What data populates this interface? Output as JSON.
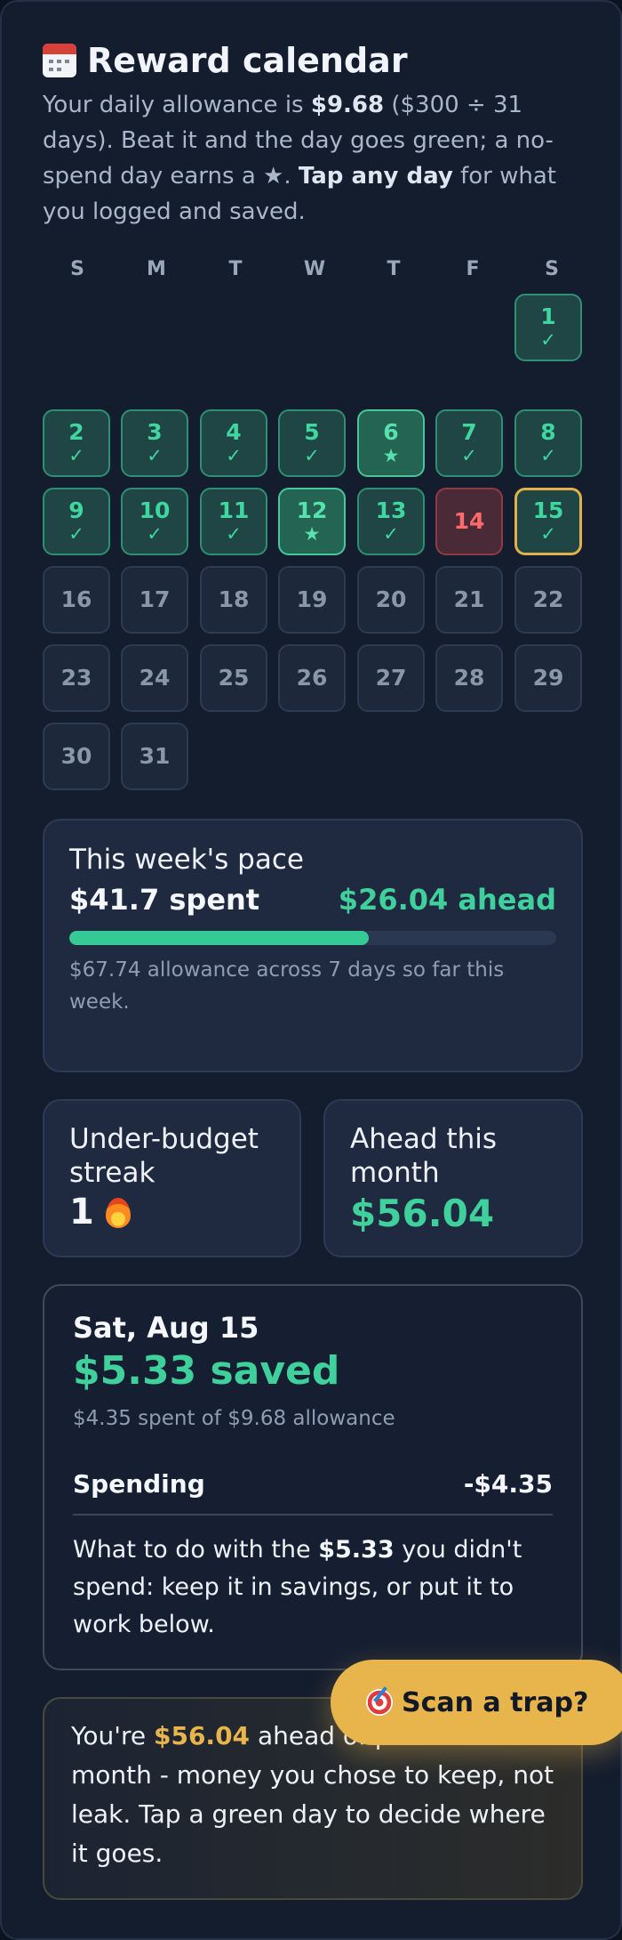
{
  "header": {
    "title": "Reward calendar",
    "intro_a": "Your daily allowance is ",
    "intro_b": "$9.68",
    "intro_c": " ($300 ÷ 31 days). Beat it and the day goes green; a no-spend day earns a ★. ",
    "intro_d": "Tap any day",
    "intro_e": " for what you logged and saved."
  },
  "calendar": {
    "weekdays": [
      "S",
      "M",
      "T",
      "W",
      "T",
      "F",
      "S"
    ],
    "days": [
      {
        "n": "1",
        "mark": "✓",
        "state": "green"
      },
      {
        "n": "2",
        "mark": "✓",
        "state": "green"
      },
      {
        "n": "3",
        "mark": "✓",
        "state": "green"
      },
      {
        "n": "4",
        "mark": "✓",
        "state": "green"
      },
      {
        "n": "5",
        "mark": "✓",
        "state": "green"
      },
      {
        "n": "6",
        "mark": "★",
        "state": "star"
      },
      {
        "n": "7",
        "mark": "✓",
        "state": "green"
      },
      {
        "n": "8",
        "mark": "✓",
        "state": "green"
      },
      {
        "n": "9",
        "mark": "✓",
        "state": "green"
      },
      {
        "n": "10",
        "mark": "✓",
        "state": "green"
      },
      {
        "n": "11",
        "mark": "✓",
        "state": "green"
      },
      {
        "n": "12",
        "mark": "★",
        "state": "star"
      },
      {
        "n": "13",
        "mark": "✓",
        "state": "green"
      },
      {
        "n": "14",
        "mark": "",
        "state": "red"
      },
      {
        "n": "15",
        "mark": "✓",
        "state": "green-selected"
      },
      {
        "n": "16",
        "mark": "",
        "state": "future"
      },
      {
        "n": "17",
        "mark": "",
        "state": "future"
      },
      {
        "n": "18",
        "mark": "",
        "state": "future"
      },
      {
        "n": "19",
        "mark": "",
        "state": "future"
      },
      {
        "n": "20",
        "mark": "",
        "state": "future"
      },
      {
        "n": "21",
        "mark": "",
        "state": "future"
      },
      {
        "n": "22",
        "mark": "",
        "state": "future"
      },
      {
        "n": "23",
        "mark": "",
        "state": "future"
      },
      {
        "n": "24",
        "mark": "",
        "state": "future"
      },
      {
        "n": "25",
        "mark": "",
        "state": "future"
      },
      {
        "n": "26",
        "mark": "",
        "state": "future"
      },
      {
        "n": "27",
        "mark": "",
        "state": "future"
      },
      {
        "n": "28",
        "mark": "",
        "state": "future"
      },
      {
        "n": "29",
        "mark": "",
        "state": "future"
      },
      {
        "n": "30",
        "mark": "",
        "state": "future"
      },
      {
        "n": "31",
        "mark": "",
        "state": "future"
      }
    ]
  },
  "pace": {
    "label": "This week's pace",
    "spent": "$41.7 spent",
    "ahead": "$26.04 ahead",
    "progress": 0.6157,
    "note": "$67.74 allowance across 7 days so far this week."
  },
  "streak": {
    "label": "Under-budget streak",
    "value": "1"
  },
  "month": {
    "label": "Ahead this month",
    "value": "$56.04"
  },
  "detail": {
    "date": "Sat, Aug 15",
    "saved": "$5.33 saved",
    "sub": "$4.35 spent of $9.68 allowance",
    "row_label": "Spending",
    "row_value": "-$4.35",
    "text_a": "What to do with the ",
    "text_b": "$5.33",
    "text_c": " you didn't spend: keep it in savings, or put it to work below."
  },
  "ahead_card": {
    "text_a": "You're ",
    "amount": "$56.04",
    "text_b": " ahead of pace this month - money you chose to keep, not leak. Tap a green day to decide where it goes."
  },
  "fab": {
    "label": "Scan a trap?"
  },
  "colors": {
    "accent_green": "#3fd09c",
    "accent_gold": "#e8b44c",
    "alert_red": "#ff6b6b"
  }
}
